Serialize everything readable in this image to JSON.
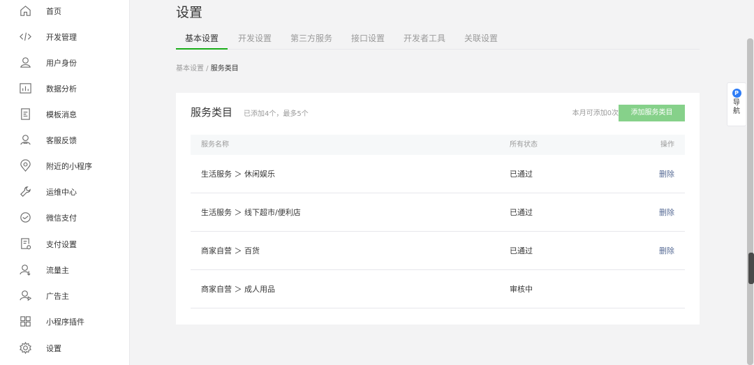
{
  "sidebar": {
    "items": [
      {
        "label": "首页",
        "icon": "home-icon"
      },
      {
        "label": "开发管理",
        "icon": "code-icon"
      },
      {
        "label": "用户身份",
        "icon": "user-icon"
      },
      {
        "label": "数据分析",
        "icon": "chart-icon"
      },
      {
        "label": "模板消息",
        "icon": "template-icon"
      },
      {
        "label": "客服反馈",
        "icon": "service-icon"
      },
      {
        "label": "附近的小程序",
        "icon": "location-icon"
      },
      {
        "label": "运维中心",
        "icon": "wrench-icon"
      },
      {
        "label": "微信支付",
        "icon": "pay-icon"
      },
      {
        "label": "支付设置",
        "icon": "pay-settings-icon"
      },
      {
        "label": "流量主",
        "icon": "traffic-icon"
      },
      {
        "label": "广告主",
        "icon": "advertiser-icon"
      },
      {
        "label": "小程序插件",
        "icon": "plugin-icon"
      },
      {
        "label": "设置",
        "icon": "gear-icon"
      }
    ]
  },
  "page": {
    "title": "设置"
  },
  "tabs": [
    {
      "label": "基本设置",
      "active": true
    },
    {
      "label": "开发设置"
    },
    {
      "label": "第三方服务"
    },
    {
      "label": "接口设置"
    },
    {
      "label": "开发者工具"
    },
    {
      "label": "关联设置"
    }
  ],
  "breadcrumb": {
    "parent": "基本设置",
    "sep": " / ",
    "current": "服务类目"
  },
  "card": {
    "title": "服务类目",
    "subtitle": "已添加4个，最多5个",
    "quota": "本月可添加0次",
    "add_button": "添加服务类目"
  },
  "table": {
    "headers": {
      "name": "服务名称",
      "status": "所有状态",
      "action": "操作"
    },
    "rows": [
      {
        "name": "生活服务 ＞ 休闲娱乐",
        "status": "已通过",
        "action": "删除"
      },
      {
        "name": "生活服务 ＞ 线下超市/便利店",
        "status": "已通过",
        "action": "删除"
      },
      {
        "name": "商家自营 ＞ 百货",
        "status": "已通过",
        "action": "删除"
      },
      {
        "name": "商家自营 ＞ 成人用品",
        "status": "审核中",
        "action": ""
      }
    ]
  },
  "float_guide": {
    "badge": "P",
    "label": "导航"
  },
  "colors": {
    "accent": "#1aad19",
    "button_disabled": "#86d18a",
    "link": "#576b95"
  }
}
